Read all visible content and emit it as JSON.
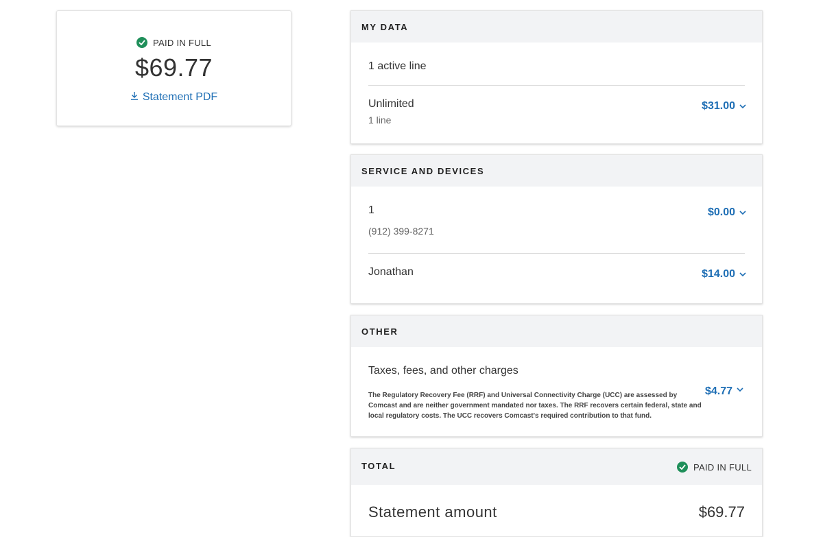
{
  "summary": {
    "status": "PAID IN FULL",
    "amount": "$69.77",
    "pdf_link": "Statement PDF"
  },
  "sections": {
    "my_data": {
      "header": "MY DATA",
      "active_lines": "1 active line",
      "plan_title": "Unlimited",
      "plan_sub": "1 line",
      "plan_price": "$31.00"
    },
    "service": {
      "header": "SERVICE AND DEVICES",
      "line1_title": "1",
      "line1_phone": "(912) 399-8271",
      "line1_price": "$0.00",
      "line2_title": "Jonathan",
      "line2_price": "$14.00"
    },
    "other": {
      "header": "OTHER",
      "taxes_title": "Taxes, fees, and other charges",
      "taxes_note": "The Regulatory Recovery Fee (RRF) and Universal Connectivity Charge (UCC) are assessed by Comcast and are neither government mandated nor taxes. The RRF recovers certain federal, state and local regulatory costs. The UCC recovers Comcast's required contribution to that fund.",
      "taxes_price": "$4.77"
    },
    "total": {
      "header": "TOTAL",
      "status": "PAID IN FULL",
      "label": "Statement amount",
      "amount": "$69.77"
    }
  },
  "colors": {
    "accent": "#1f6fb5",
    "success": "#1f8f5a",
    "header_bg": "#f2f3f5"
  }
}
